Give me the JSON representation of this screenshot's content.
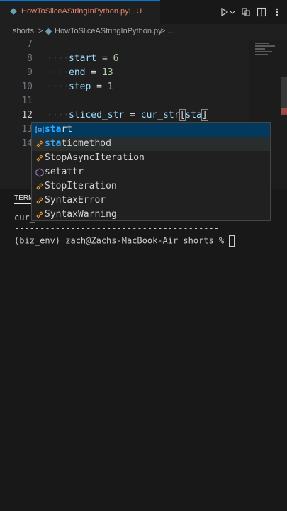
{
  "tab": {
    "filename": "HowToSliceAStringInPython.py",
    "badge": "1, U"
  },
  "breadcrumb": {
    "folder": "shorts",
    "sep1": ">",
    "file": "HowToSliceAStringInPython.py",
    "sep2": ">",
    "more": "..."
  },
  "editor": {
    "lines": [
      {
        "num": "7",
        "text": ""
      },
      {
        "num": "8",
        "var": "start",
        "op": " = ",
        "val": "6"
      },
      {
        "num": "9",
        "var": "end",
        "op": " = ",
        "val": "13"
      },
      {
        "num": "10",
        "var": "step",
        "op": " = ",
        "val": "1"
      },
      {
        "num": "11",
        "text": ""
      },
      {
        "num": "12",
        "lhs": "sliced_str",
        "op": " = ",
        "rhs": "cur_str",
        "open": "[",
        "typed": "sta",
        "close": "]"
      },
      {
        "num": "13",
        "text": ""
      },
      {
        "num": "14",
        "text": ""
      }
    ]
  },
  "suggestions": [
    {
      "label_hl": "sta",
      "label_rest": "rt",
      "kind": "variable"
    },
    {
      "label_hl": "sta",
      "label_rest": "ticmethod",
      "kind": "class"
    },
    {
      "label_pre": "",
      "label": "StopAsyncIteration",
      "kind": "class"
    },
    {
      "label": "setattr",
      "kind": "function"
    },
    {
      "label": "StopIteration",
      "kind": "class"
    },
    {
      "label": "SyntaxError",
      "kind": "class"
    },
    {
      "label": "SyntaxWarning",
      "kind": "class"
    }
  ],
  "terminal": {
    "tab_label": "TERM",
    "line1": "cur_",
    "divider": "----------------------------------------",
    "prompt": "(biz_env) zach@Zachs-MacBook-Air shorts % "
  },
  "colors": {
    "accent": "#0078d4",
    "tab_modified": "#e4836c",
    "highlight": "#2aaaff",
    "selection": "#04395e"
  }
}
